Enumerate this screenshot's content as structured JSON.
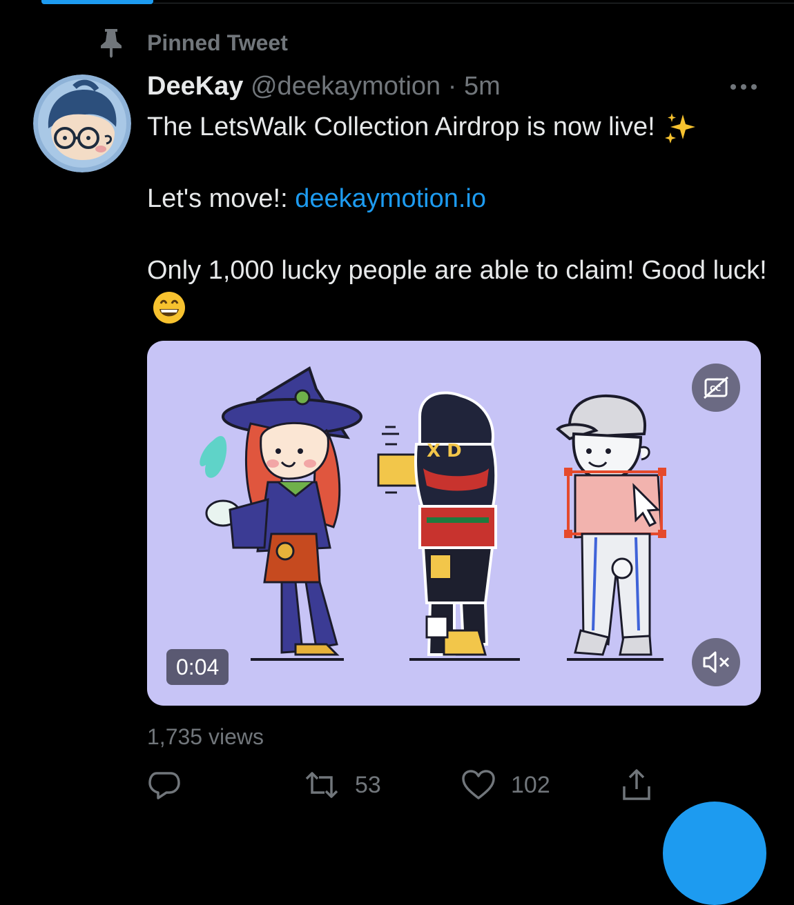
{
  "colors": {
    "accent": "#1d9bf0",
    "background": "#000000",
    "text": "#e7e9ea",
    "muted": "#71767b"
  },
  "pinned": {
    "label": "Pinned Tweet",
    "icon": "pin-icon"
  },
  "tweet": {
    "display_name": "DeeKay",
    "handle": "@deekaymotion",
    "separator": "·",
    "time": "5m",
    "line1": "The LetsWalk Collection Airdrop is now live!",
    "line2_prefix": "Let's move!:",
    "link": "deekaymotion.io",
    "line3": "Only 1,000 lucky people are able to claim! Good luck!",
    "emoji_icons": [
      "sparkles-icon",
      "grinning-face-icon"
    ]
  },
  "media": {
    "type": "video",
    "timestamp": "0:04",
    "background": "#c7c4f6",
    "controls": [
      "captions-off-icon",
      "volume-muted-icon"
    ]
  },
  "stats": {
    "views": "1,735 views"
  },
  "actions": {
    "reply_count": "",
    "retweet_count": "53",
    "like_count": "102",
    "icons": [
      "reply-icon",
      "retweet-icon",
      "like-icon",
      "share-icon"
    ]
  }
}
